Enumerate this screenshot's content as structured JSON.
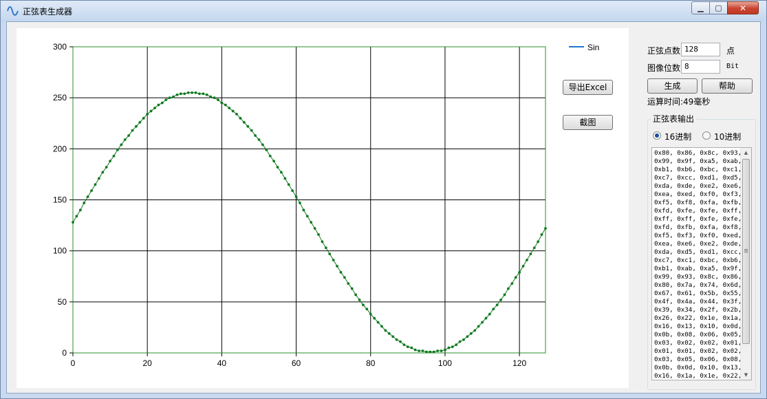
{
  "window": {
    "title": "正弦表生成器",
    "app_icon": "sine-wave-icon",
    "minimize_glyph": "▁",
    "maximize_glyph": "▢",
    "close_glyph": "✕"
  },
  "controls": {
    "points_label": "正弦点数",
    "points_value": "128",
    "points_unit": "点",
    "bits_label": "图像位数",
    "bits_value": "8",
    "bits_unit": "Bit",
    "generate_button": "生成",
    "help_button": "帮助",
    "compute_time": "运算时间:49毫秒",
    "export_excel_button": "导出Excel",
    "screenshot_button": "截图"
  },
  "output": {
    "group_title": "正弦表输出",
    "radio_hex_label": "16进制",
    "radio_dec_label": "10进制",
    "selected": "16进制",
    "text": "0x80, 0x86, 0x8c, 0x93,\n0x99, 0x9f, 0xa5, 0xab,\n0xb1, 0xb6, 0xbc, 0xc1,\n0xc7, 0xcc, 0xd1, 0xd5,\n0xda, 0xde, 0xe2, 0xe6,\n0xea, 0xed, 0xf0, 0xf3,\n0xf5, 0xf8, 0xfa, 0xfb,\n0xfd, 0xfe, 0xfe, 0xff,\n0xff, 0xff, 0xfe, 0xfe,\n0xfd, 0xfb, 0xfa, 0xf8,\n0xf5, 0xf3, 0xf0, 0xed,\n0xea, 0xe6, 0xe2, 0xde,\n0xda, 0xd5, 0xd1, 0xcc,\n0xc7, 0xc1, 0xbc, 0xb6,\n0xb1, 0xab, 0xa5, 0x9f,\n0x99, 0x93, 0x8c, 0x86,\n0x80, 0x7a, 0x74, 0x6d,\n0x67, 0x61, 0x5b, 0x55,\n0x4f, 0x4a, 0x44, 0x3f,\n0x39, 0x34, 0x2f, 0x2b,\n0x26, 0x22, 0x1e, 0x1a,\n0x16, 0x13, 0x10, 0x0d,\n0x0b, 0x08, 0x06, 0x05,\n0x03, 0x02, 0x02, 0x01,\n0x01, 0x01, 0x02, 0x02,\n0x03, 0x05, 0x06, 0x08,\n0x0b, 0x0d, 0x10, 0x13,\n0x16, 0x1a, 0x1e, 0x22,"
  },
  "chart_data": {
    "type": "scatter",
    "title": "",
    "xlabel": "",
    "ylabel": "",
    "xlim": [
      0,
      127
    ],
    "ylim": [
      0,
      300
    ],
    "x_ticks": [
      0,
      20,
      40,
      60,
      80,
      100,
      120
    ],
    "y_ticks": [
      0,
      50,
      100,
      150,
      200,
      250,
      300
    ],
    "grid": true,
    "legend_position": "top-right, outside plot",
    "series": [
      {
        "name": "Sin",
        "color": "#1f78d0",
        "marker_color": "#0f7a1f",
        "x_start": 0,
        "x_step": 1,
        "values": [
          128,
          134,
          140,
          147,
          153,
          159,
          165,
          171,
          177,
          182,
          188,
          193,
          199,
          204,
          209,
          213,
          218,
          222,
          226,
          230,
          234,
          237,
          240,
          243,
          245,
          248,
          250,
          251,
          253,
          254,
          254,
          255,
          255,
          255,
          254,
          254,
          253,
          251,
          250,
          248,
          245,
          243,
          240,
          237,
          234,
          230,
          226,
          222,
          218,
          213,
          209,
          204,
          199,
          193,
          188,
          182,
          177,
          171,
          165,
          159,
          153,
          147,
          140,
          134,
          128,
          122,
          116,
          109,
          103,
          97,
          91,
          85,
          79,
          74,
          68,
          63,
          57,
          52,
          47,
          43,
          38,
          34,
          30,
          26,
          22,
          19,
          16,
          13,
          11,
          8,
          6,
          5,
          3,
          2,
          2,
          1,
          1,
          1,
          2,
          2,
          3,
          5,
          6,
          8,
          11,
          13,
          16,
          19,
          22,
          26,
          30,
          34,
          38,
          43,
          47,
          52,
          57,
          63,
          68,
          74,
          79,
          85,
          91,
          97,
          103,
          109,
          116,
          122
        ]
      }
    ]
  }
}
